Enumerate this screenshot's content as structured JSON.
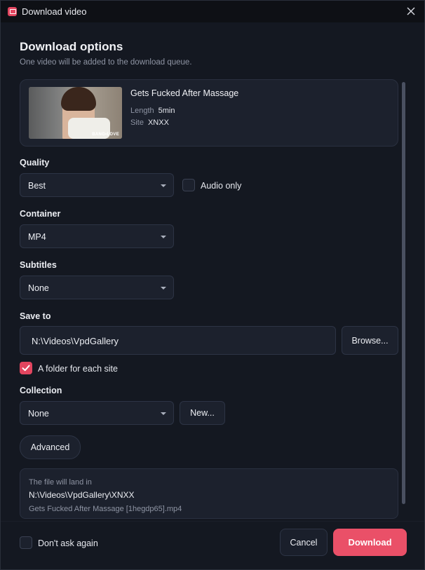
{
  "window": {
    "title": "Download video"
  },
  "header": {
    "title": "Download options",
    "subtitle": "One video will be added to the download queue."
  },
  "video": {
    "title": "Gets Fucked After Massage",
    "length_label": "Length",
    "length_value": "5min",
    "site_label": "Site",
    "site_value": "XNXX",
    "thumbnail_watermark": "BANG•LOVE"
  },
  "quality": {
    "label": "Quality",
    "value": "Best",
    "audio_only_label": "Audio only",
    "audio_only_checked": false
  },
  "container": {
    "label": "Container",
    "value": "MP4"
  },
  "subtitles": {
    "label": "Subtitles",
    "value": "None"
  },
  "save_to": {
    "label": "Save to",
    "path": "N:\\Videos\\VpdGallery",
    "browse_label": "Browse...",
    "folder_per_site_label": "A folder for each site",
    "folder_per_site_checked": true
  },
  "collection": {
    "label": "Collection",
    "value": "None",
    "new_label": "New..."
  },
  "advanced_label": "Advanced",
  "landing": {
    "note": "The file will land in",
    "path": "N:\\Videos\\VpdGallery\\XNXX",
    "filename": "Gets Fucked After Massage [1hegdp65].mp4"
  },
  "footer": {
    "dont_ask_label": "Don't ask again",
    "dont_ask_checked": false,
    "cancel_label": "Cancel",
    "download_label": "Download"
  },
  "colors": {
    "accent": "#ea5068",
    "background": "#141821",
    "panel": "#1c212d"
  }
}
